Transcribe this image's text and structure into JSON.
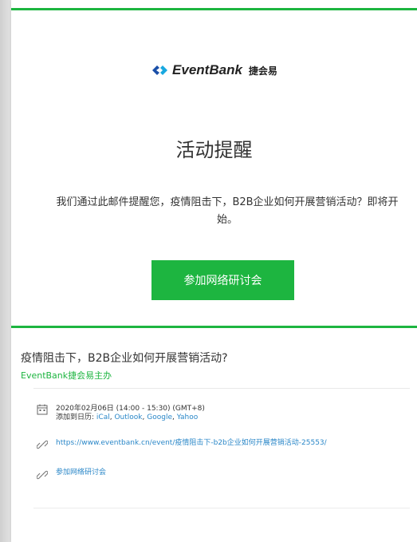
{
  "logo": {
    "brand": "EventBank",
    "brand_cn": "捷会易"
  },
  "reminder": {
    "title": "活动提醒",
    "intro": "我们通过此邮件提醒您，疫情阻击下，B2B企业如何开展营销活动？即将开始。",
    "join_button": "参加网络研讨会"
  },
  "event": {
    "title": "疫情阻击下，B2B企业如何开展营销活动?",
    "organizer": "EventBank捷会易主办",
    "datetime": "2020年02月06日 (14:00 - 15:30) (GMT+8)",
    "calendar_prefix": "添加到日历:",
    "calendars": [
      "iCal",
      "Outlook",
      "Google",
      "Yahoo"
    ],
    "url": "https://www.eventbank.cn/event/疫情阻击下-b2b企业如何开展营销活动-25553/",
    "join_link": "参加网络研讨会"
  },
  "colors": {
    "accent": "#1db540",
    "link": "#2a87c8"
  },
  "icons": {
    "brand": "eventbank-logo-icon",
    "calendar": "calendar-icon",
    "link": "link-icon"
  }
}
